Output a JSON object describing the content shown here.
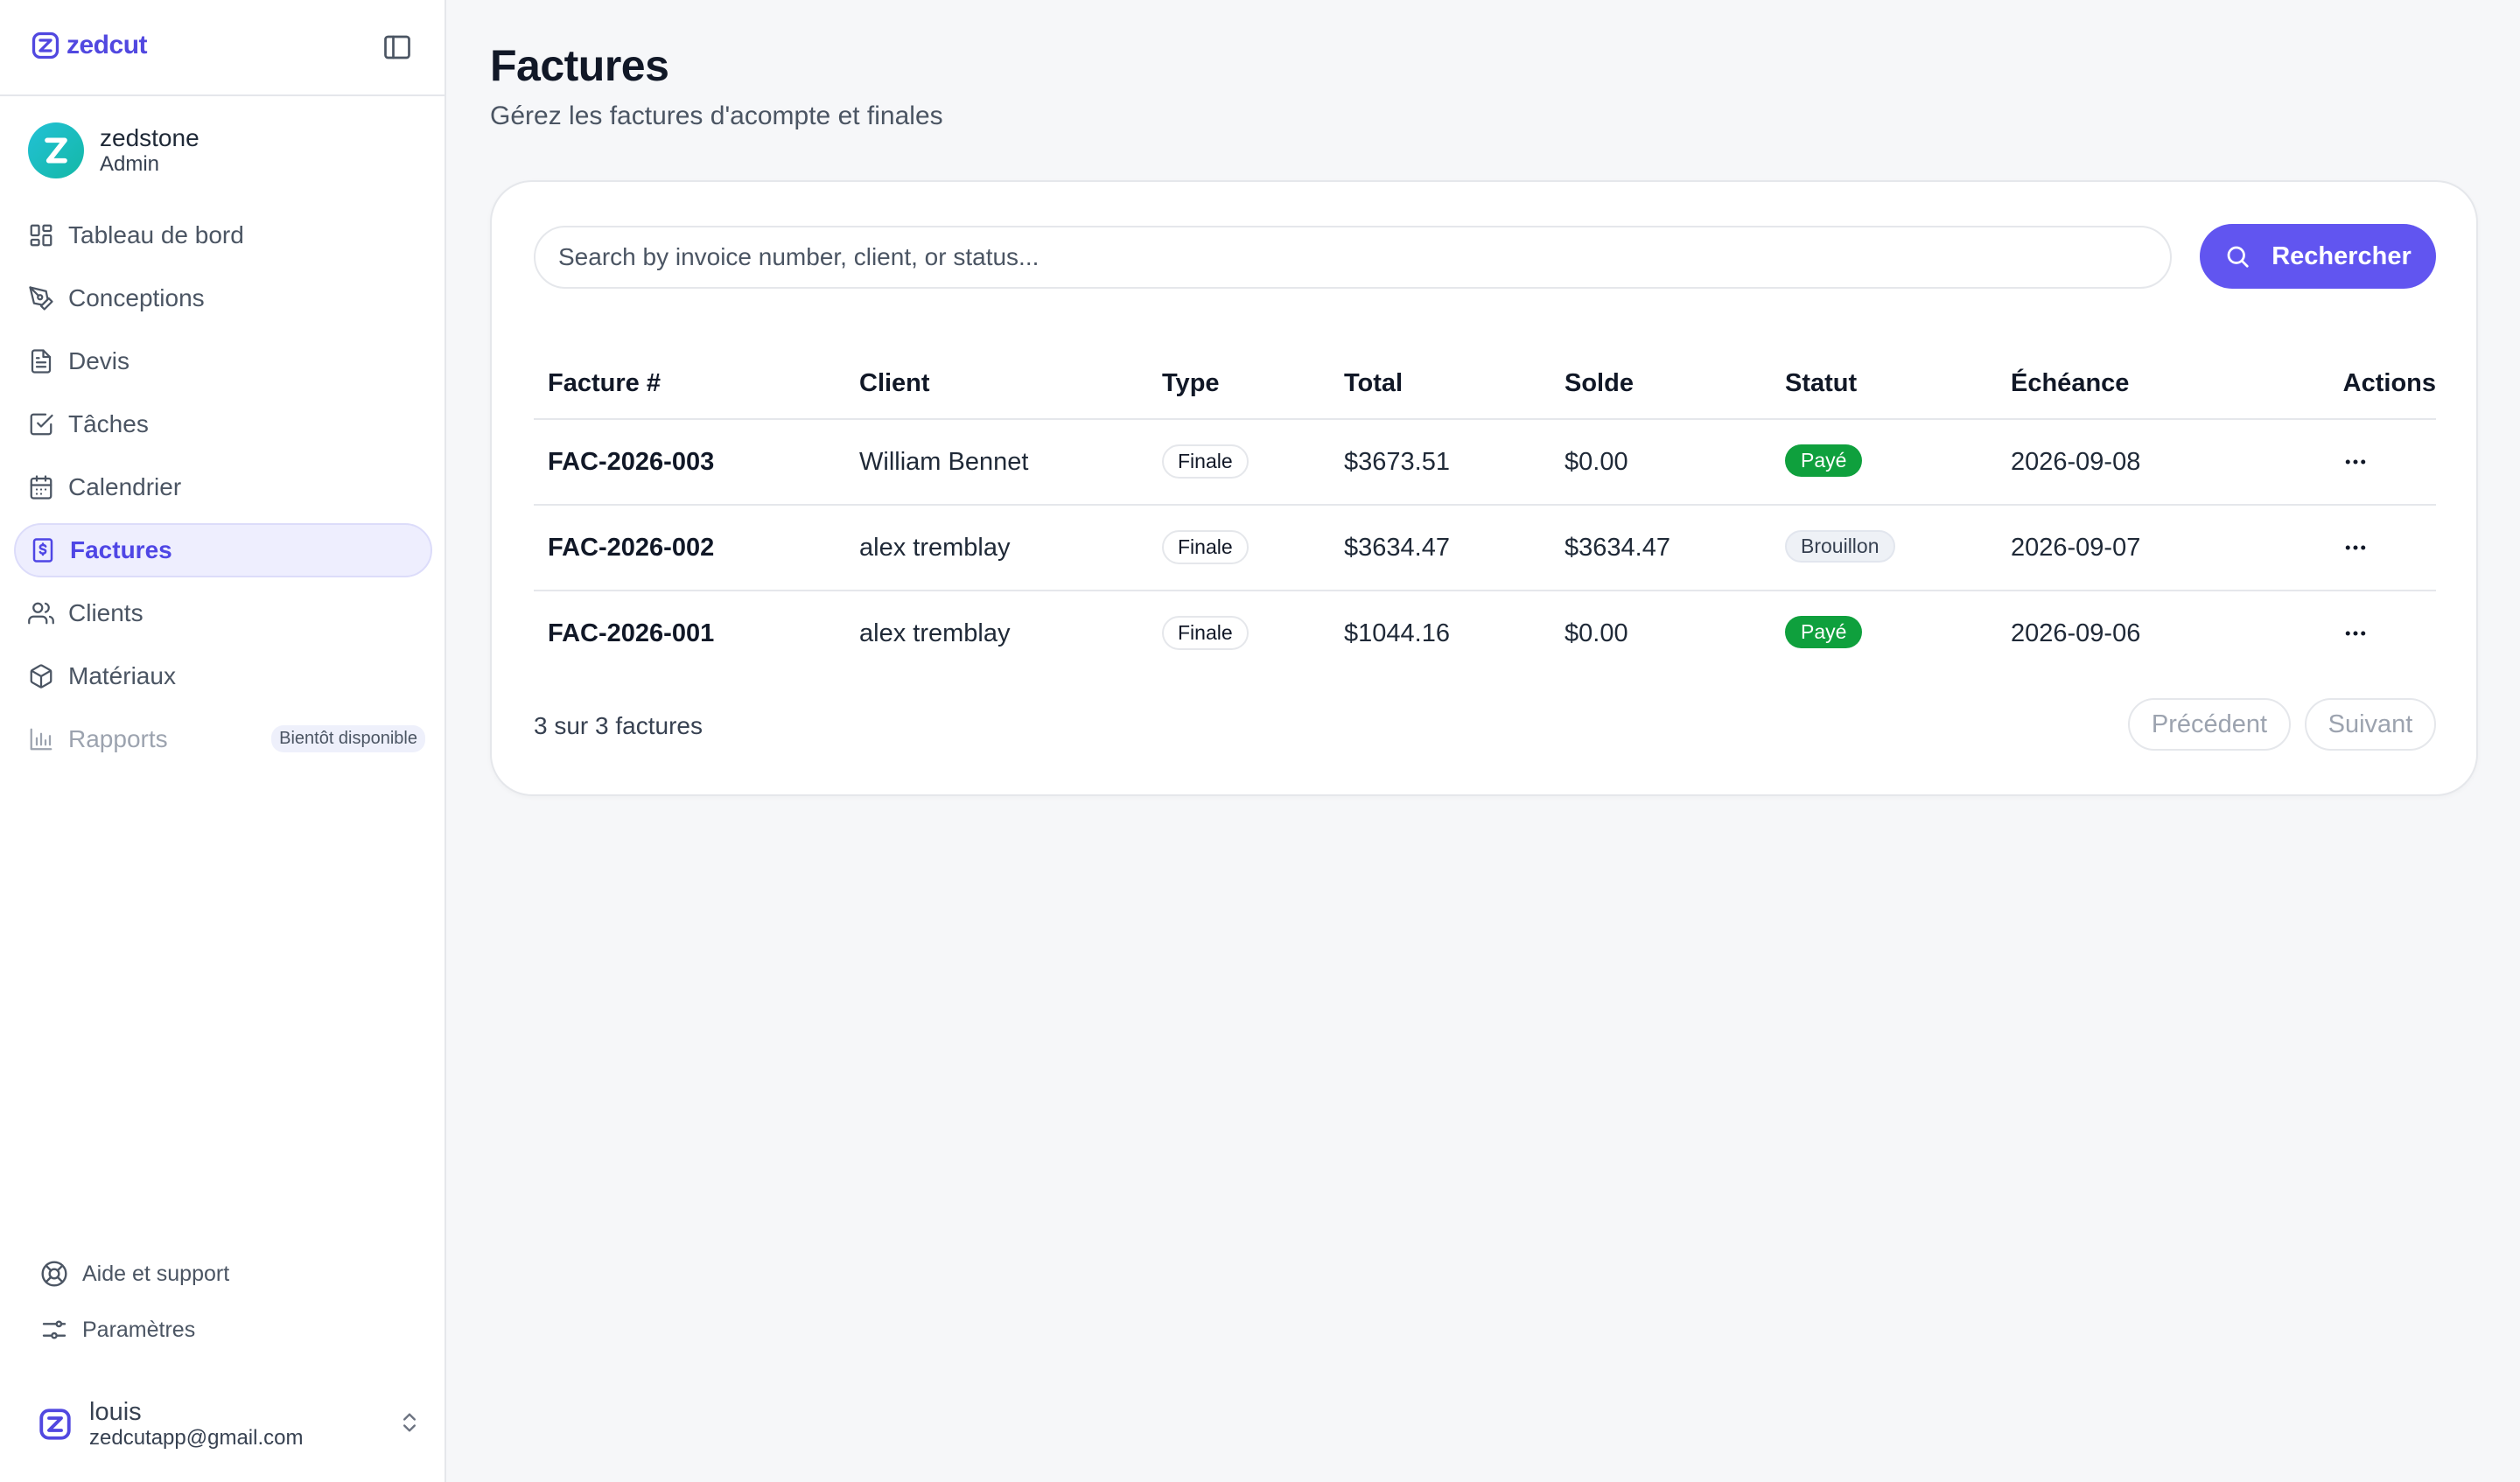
{
  "brand": {
    "name": "zedcut"
  },
  "user_top": {
    "name": "zedstone",
    "role": "Admin",
    "avatar_letter": "Z"
  },
  "sidebar": {
    "items": [
      {
        "label": "Tableau de bord",
        "icon": "dashboard-icon"
      },
      {
        "label": "Conceptions",
        "icon": "pen-tool-icon"
      },
      {
        "label": "Devis",
        "icon": "file-text-icon"
      },
      {
        "label": "Tâches",
        "icon": "check-square-icon"
      },
      {
        "label": "Calendrier",
        "icon": "calendar-icon"
      },
      {
        "label": "Factures",
        "icon": "invoice-dollar-icon",
        "active": true
      },
      {
        "label": "Clients",
        "icon": "users-icon"
      },
      {
        "label": "Matériaux",
        "icon": "package-icon"
      },
      {
        "label": "Rapports",
        "icon": "bar-chart-icon",
        "disabled": true,
        "badge": "Bientôt disponible"
      }
    ],
    "footer": [
      {
        "label": "Aide et support",
        "icon": "life-buoy-icon"
      },
      {
        "label": "Paramètres",
        "icon": "sliders-icon"
      }
    ]
  },
  "user_bottom": {
    "name": "louis",
    "email": "zedcutapp@gmail.com"
  },
  "page": {
    "title": "Factures",
    "subtitle": "Gérez les factures d'acompte et finales"
  },
  "search": {
    "placeholder": "Search by invoice number, client, or status...",
    "value": "",
    "button_label": "Rechercher"
  },
  "table": {
    "headers": [
      "Facture #",
      "Client",
      "Type",
      "Total",
      "Solde",
      "Statut",
      "Échéance",
      "Actions"
    ],
    "rows": [
      {
        "number": "FAC-2026-003",
        "client": "William Bennet",
        "type": "Finale",
        "total": "$3673.51",
        "balance": "$0.00",
        "status": "Payé",
        "due": "2026-09-08"
      },
      {
        "number": "FAC-2026-002",
        "client": "alex tremblay",
        "type": "Finale",
        "total": "$3634.47",
        "balance": "$3634.47",
        "status": "Brouillon",
        "due": "2026-09-07"
      },
      {
        "number": "FAC-2026-001",
        "client": "alex tremblay",
        "type": "Finale",
        "total": "$1044.16",
        "balance": "$0.00",
        "status": "Payé",
        "due": "2026-09-06"
      }
    ]
  },
  "pagination": {
    "summary": "3 sur 3 factures",
    "prev_label": "Précédent",
    "next_label": "Suivant"
  },
  "colors": {
    "accent": "#6155f0",
    "brand": "#5148e0",
    "paid": "#0fa03d",
    "draft_bg": "#eef1f6"
  }
}
